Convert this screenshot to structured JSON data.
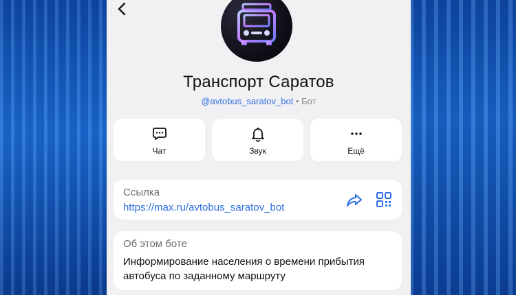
{
  "header": {
    "back_icon": "chevron-left-icon"
  },
  "profile": {
    "avatar_icon": "bus-icon",
    "title": "Транспорт Саратов",
    "handle": "@avtobus_saratov_bot",
    "separator": "•",
    "type": "Бот"
  },
  "actions": [
    {
      "label": "Чат",
      "icon": "chat-icon"
    },
    {
      "label": "Звук",
      "icon": "bell-icon"
    },
    {
      "label": "Ещё",
      "icon": "more-icon"
    }
  ],
  "link_card": {
    "label": "Ссылка",
    "url": "https://max.ru/avtobus_saratov_bot",
    "share_icon": "share-icon",
    "qr_icon": "qr-code-icon"
  },
  "about_card": {
    "label": "Об этом боте",
    "text": "Информирование населения о времени прибытия автобуса по заданному маршруту"
  },
  "colors": {
    "accent": "#2f6fe0",
    "background": "#f1f1f3",
    "card": "#ffffff"
  }
}
